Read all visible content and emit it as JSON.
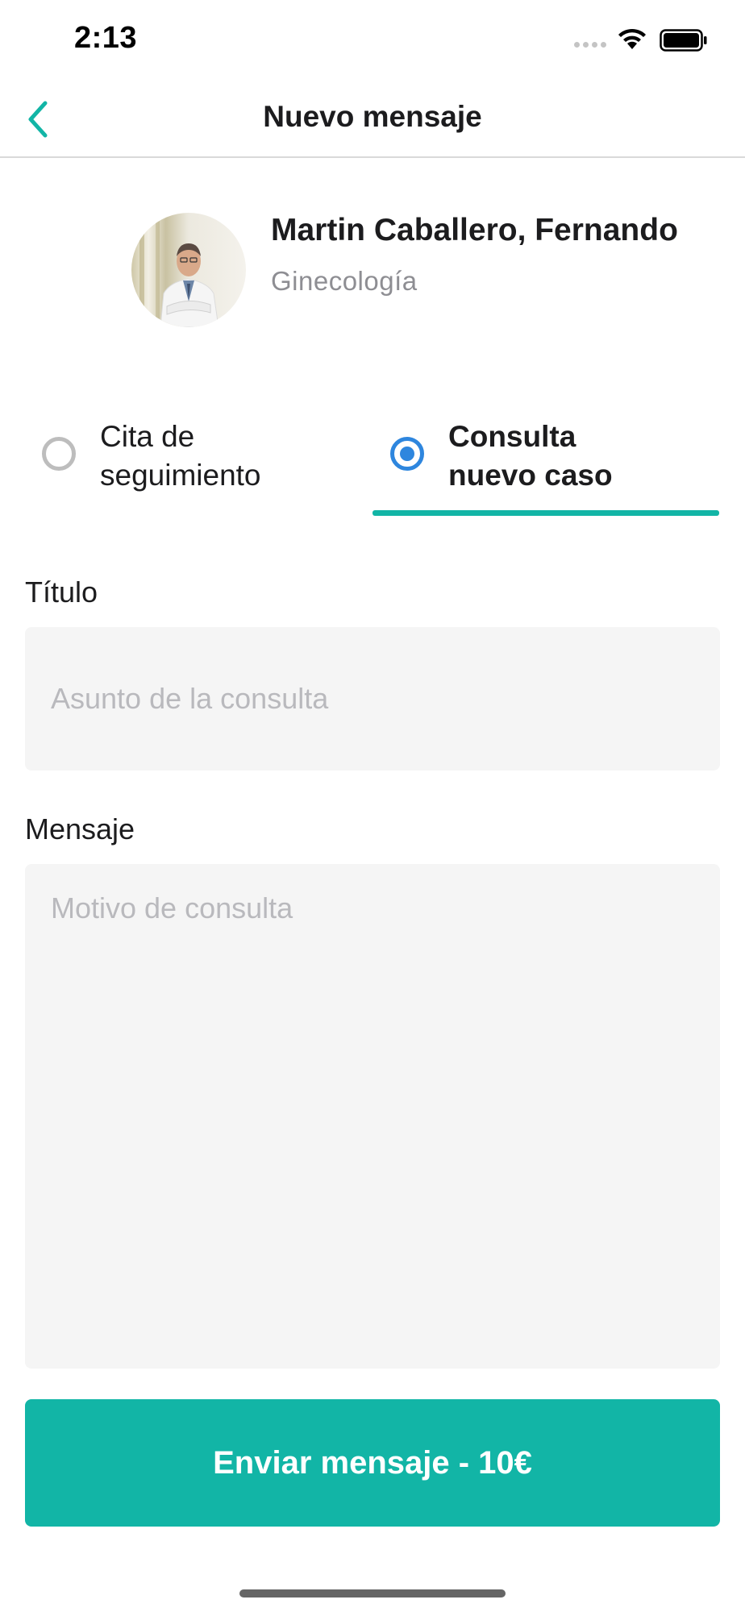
{
  "status_bar": {
    "time": "2:13",
    "icons": [
      "cellular-icon",
      "wifi-icon",
      "battery-icon"
    ]
  },
  "nav": {
    "title": "Nuevo mensaje",
    "back_icon": "chevron-left-icon"
  },
  "doctor": {
    "name": "Martin Caballero, Fernando",
    "specialty": "Ginecología"
  },
  "options": [
    {
      "label_line1": "Cita de",
      "label_line2": "seguimiento",
      "selected": false
    },
    {
      "label_line1": "Consulta",
      "label_line2": "nuevo caso",
      "selected": true
    }
  ],
  "form": {
    "title_label": "Título",
    "title_placeholder": "Asunto de la consulta",
    "title_value": "",
    "message_label": "Mensaje",
    "message_placeholder": "Motivo de consulta",
    "message_value": ""
  },
  "send_button": {
    "label": "Enviar mensaje - 10€"
  },
  "colors": {
    "accent": "#12b5a6",
    "radio_selected": "#2e86de",
    "input_bg": "#f5f5f5"
  }
}
